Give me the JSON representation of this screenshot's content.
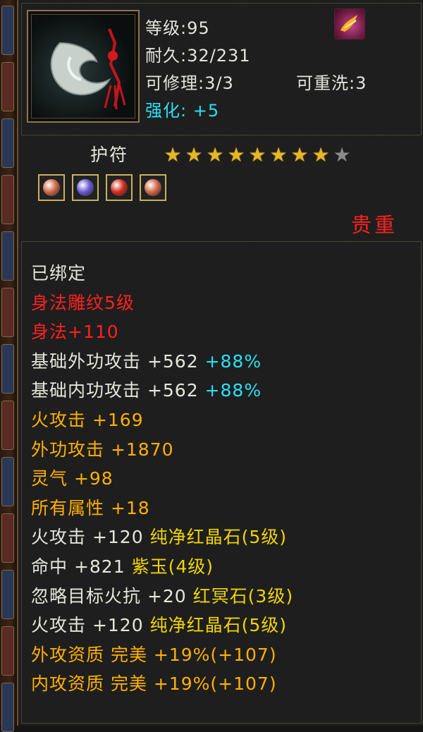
{
  "item": {
    "level_label": "等级:",
    "level_value": "95",
    "durability_label": "耐久:",
    "durability_value": "32/231",
    "repair_label": "可修理:",
    "repair_value": "3/3",
    "rewash_label": "可重洗:",
    "rewash_value": "3",
    "enhance_label": "强化:",
    "enhance_value": "+5",
    "name": "护符",
    "stars_filled": 8,
    "stars_total": 9,
    "rarity": "贵重",
    "icon": "jade-amulet-icon",
    "badge_icon": "phoenix-badge-icon"
  },
  "gems": [
    {
      "icon": "gem-red-green-icon",
      "color": "#d06a4a"
    },
    {
      "icon": "gem-purple-icon",
      "color": "#6a5ad0"
    },
    {
      "icon": "gem-red-icon",
      "color": "#d03020"
    },
    {
      "icon": "gem-red-green-icon",
      "color": "#d06a4a"
    }
  ],
  "stats": [
    {
      "text": "已绑定",
      "color": "light"
    },
    {
      "text": "身法雕纹5级",
      "color": "red"
    },
    {
      "text": "身法+110",
      "color": "red"
    },
    {
      "text": "基础外功攻击 +562",
      "extra": " +88%",
      "color": "light",
      "extra_color": "cyan"
    },
    {
      "text": "基础内功攻击 +562",
      "extra": " +88%",
      "color": "light",
      "extra_color": "cyan"
    },
    {
      "text": "火攻击 +169",
      "color": "orange"
    },
    {
      "text": "外功攻击 +1870",
      "color": "orange"
    },
    {
      "text": "灵气 +98",
      "color": "orange"
    },
    {
      "text": "所有属性 +18",
      "color": "orange"
    },
    {
      "text": "火攻击 +120 ",
      "extra": "纯净红晶石(5级)",
      "color": "light",
      "extra_color": "yellow"
    },
    {
      "text": "命中 +821 ",
      "extra": "紫玉(4级)",
      "color": "light",
      "extra_color": "yellow"
    },
    {
      "text": "忽略目标火抗 +20 ",
      "extra": "红冥石(3级)",
      "color": "light",
      "extra_color": "yellow"
    },
    {
      "text": "火攻击 +120 ",
      "extra": "纯净红晶石(5级)",
      "color": "light",
      "extra_color": "yellow"
    },
    {
      "text": "外攻资质  完美 +19%(+107)",
      "color": "orange"
    },
    {
      "text": "内攻资质  完美 +19%(+107)",
      "color": "orange"
    }
  ]
}
